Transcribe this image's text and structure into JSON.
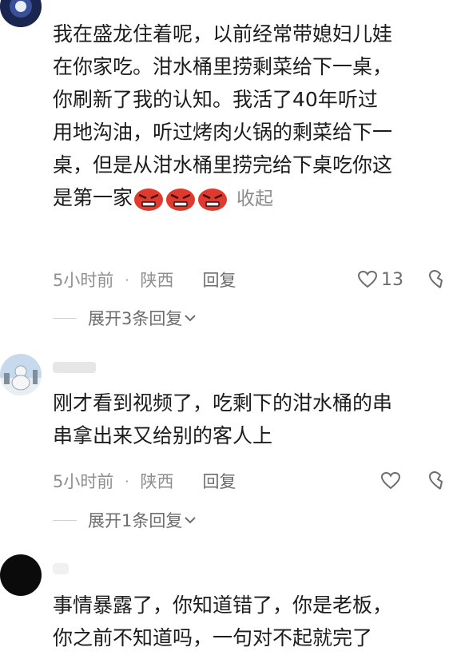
{
  "comments": [
    {
      "lines": [
        "我在盛龙住着呢，以前经常带媳妇儿娃",
        "在你家吃。泔水桶里捞剩菜给下一桌，",
        "你刷新了我的认知。我活了40年听过",
        "用地沟油，听过烤肉火锅的剩菜给下一",
        "桌，但是从泔水桶里捞完给下桌吃你这",
        "是第一家"
      ],
      "collapse_label": "收起",
      "time": "5小时前",
      "region": "陕西",
      "reply_label": "回复",
      "likes": "13",
      "expand_label": "展开3条回复"
    },
    {
      "lines": [
        "刚才看到视频了，吃剩下的泔水桶的串",
        "串拿出来又给别的客人上"
      ],
      "time": "5小时前",
      "region": "陕西",
      "reply_label": "回复",
      "expand_label": "展开1条回复"
    },
    {
      "lines": [
        "事情暴露了，你知道错了，你是老板，",
        "你之前不知道吗，一句对不起就完了"
      ]
    }
  ],
  "icons": {
    "like": "heart-outline-icon",
    "dislike": "broken-heart-icon",
    "expand": "chevron-down-icon",
    "emoji": "angry-face-emoji"
  },
  "colors": {
    "text": "#1c1c1c",
    "meta": "#8f8f8f",
    "emoji_red": "#e03a2f"
  }
}
